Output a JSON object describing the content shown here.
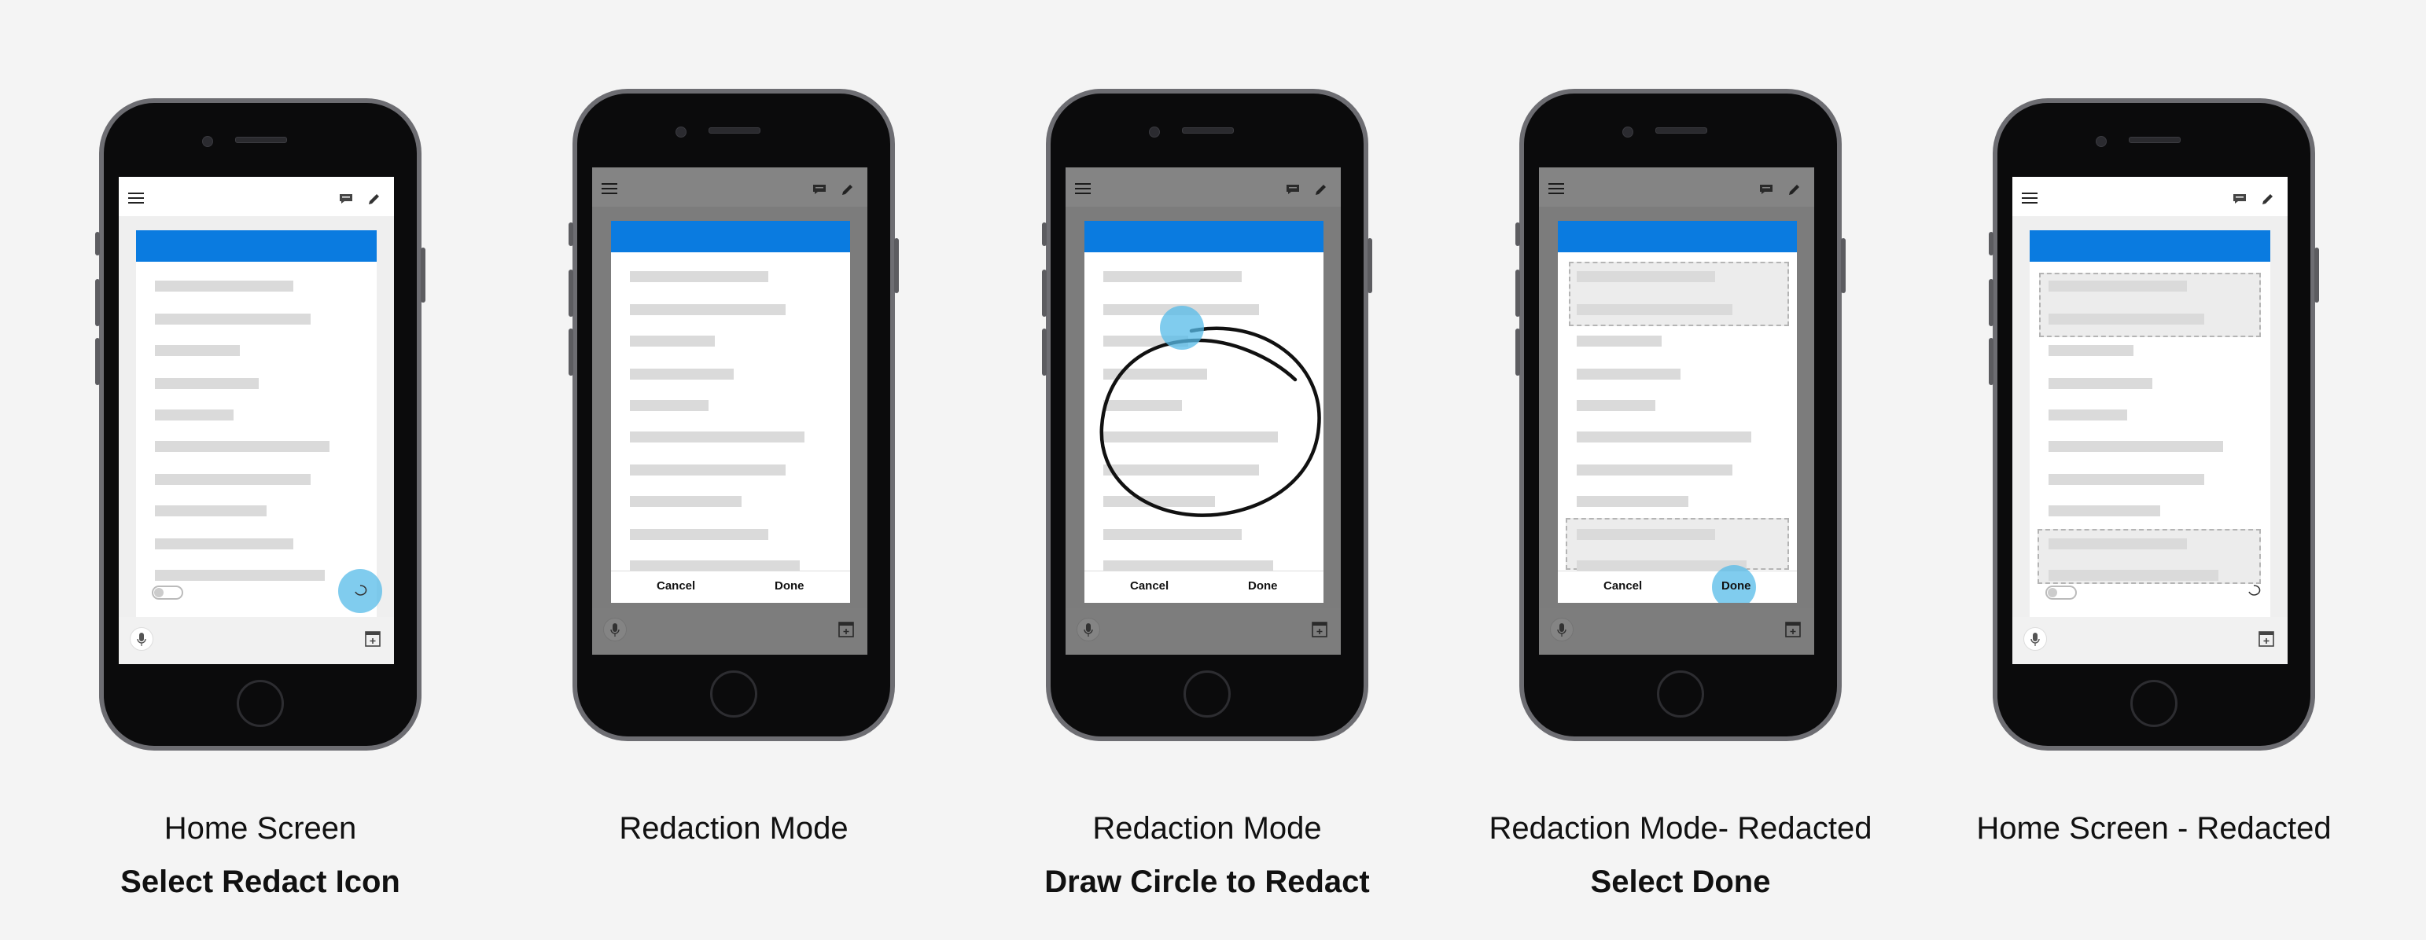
{
  "screens": [
    {
      "caption": "Home Screen",
      "subcaption": "Select Redact Icon"
    },
    {
      "caption": "Redaction Mode",
      "subcaption": "",
      "cancel": "Cancel",
      "done": "Done"
    },
    {
      "caption": "Redaction Mode",
      "subcaption": "Draw Circle to Redact",
      "cancel": "Cancel",
      "done": "Done"
    },
    {
      "caption": "Redaction Mode- Redacted",
      "subcaption": "Select Done",
      "cancel": "Cancel",
      "done": "Done"
    },
    {
      "caption": "Home Screen - Redacted",
      "subcaption": ""
    }
  ],
  "colors": {
    "background": "#f4f4f4",
    "accent_blue": "#0a7be0",
    "tap_indicator": "#56bbe8",
    "overlay": "rgba(20,20,20,0.52)"
  },
  "icons": [
    "menu-icon",
    "chat-icon",
    "pencil-icon",
    "lasso-redact-icon",
    "mic-icon",
    "add-note-icon",
    "toggle-switch"
  ]
}
